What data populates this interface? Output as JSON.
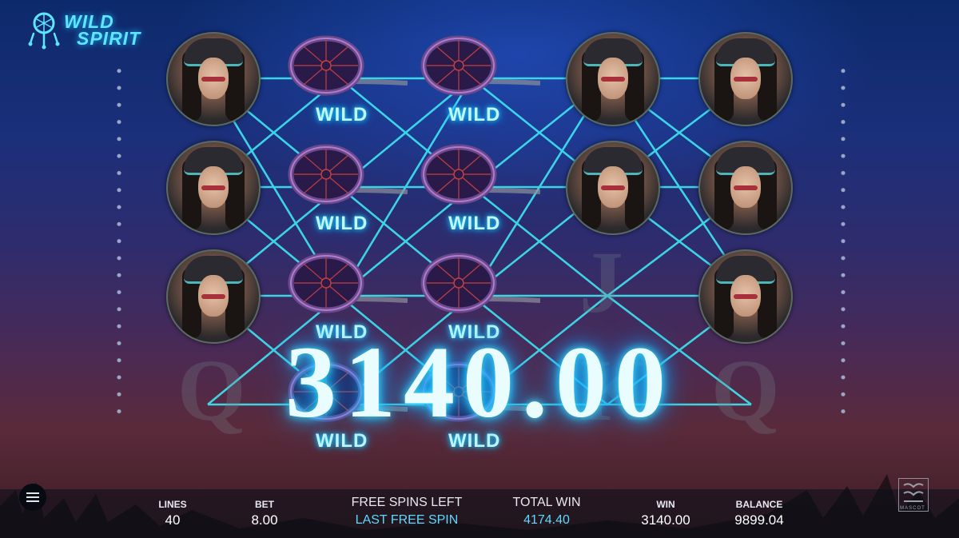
{
  "game": {
    "logo_line1": "WILD",
    "logo_line2": "SPIRIT",
    "accent_color": "#5fe6ff"
  },
  "reels": {
    "symbols": [
      [
        "warrior-woman",
        "warrior-woman",
        "warrior-woman",
        "hidden"
      ],
      [
        "wild",
        "wild",
        "wild",
        "wild"
      ],
      [
        "wild",
        "wild",
        "wild",
        "wild"
      ],
      [
        "warrior-woman",
        "warrior-woman",
        "J",
        "K"
      ],
      [
        "warrior-woman",
        "warrior-woman",
        "warrior-woman",
        "Q"
      ]
    ],
    "wild_label": "WILD",
    "ghost_q_left": "Q",
    "ghost_j": "J",
    "ghost_k": "K",
    "ghost_q_right": "Q"
  },
  "win_overlay": {
    "amount": "3140.00"
  },
  "bottom_bar": {
    "lines_label": "LINES",
    "lines_value": "40",
    "bet_label": "BET",
    "bet_value": "8.00",
    "free_spins_label": "FREE SPINS LEFT",
    "free_spins_value": "LAST FREE SPIN",
    "total_win_label": "TOTAL WIN",
    "total_win_value": "4174.40",
    "win_label": "WIN",
    "win_value": "3140.00",
    "balance_label": "BALANCE",
    "balance_value": "9899.04",
    "provider": "MASCOT"
  },
  "icons": {
    "menu": "menu-icon",
    "logo": "dreamcatcher-icon",
    "provider": "mascot-logo-icon"
  }
}
